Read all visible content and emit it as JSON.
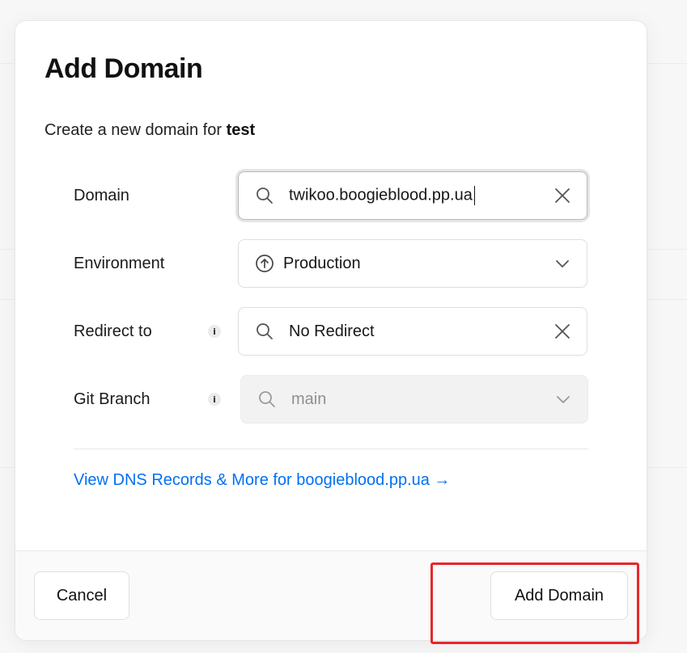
{
  "modal": {
    "title": "Add Domain",
    "subtitle_prefix": "Create a new domain for ",
    "project_name": "test"
  },
  "form": {
    "domain": {
      "label": "Domain",
      "value": "twikoo.boogieblood.pp.ua",
      "leading_icon": "search-icon",
      "trailing_icon": "close-icon"
    },
    "environment": {
      "label": "Environment",
      "value": "Production",
      "leading_icon": "arrow-up-circle-icon",
      "trailing_icon": "chevron-down-icon"
    },
    "redirect": {
      "label": "Redirect to",
      "info_icon": "info-icon",
      "value": "No Redirect",
      "leading_icon": "search-icon",
      "trailing_icon": "close-icon"
    },
    "git_branch": {
      "label": "Git Branch",
      "info_icon": "info-icon",
      "placeholder": "main",
      "leading_icon": "search-icon",
      "trailing_icon": "chevron-down-icon",
      "disabled": true
    }
  },
  "dns_link": {
    "text": "View DNS Records & More for boogieblood.pp.ua →"
  },
  "footer": {
    "cancel_label": "Cancel",
    "add_label": "Add Domain"
  },
  "colors": {
    "link": "#0070f3",
    "highlight": "#e8262b",
    "disabled_bg": "#f2f2f2"
  }
}
